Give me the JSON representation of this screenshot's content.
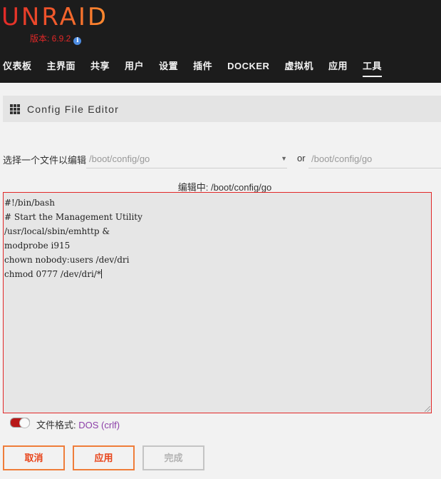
{
  "header": {
    "logo": "UNRAID",
    "version": "版本: 6.9.2",
    "info_icon": "info-icon",
    "nav": [
      {
        "label": "仪表板"
      },
      {
        "label": "主界面"
      },
      {
        "label": "共享"
      },
      {
        "label": "用户"
      },
      {
        "label": "设置"
      },
      {
        "label": "插件"
      },
      {
        "label": "DOCKER"
      },
      {
        "label": "虚拟机"
      },
      {
        "label": "应用"
      },
      {
        "label": "工具",
        "active": true
      }
    ]
  },
  "page": {
    "title": "Config File Editor",
    "title_icon": "grid-icon"
  },
  "file_select": {
    "label": "选择一个文件以编辑",
    "selected": "/boot/config/go",
    "or_label": "or",
    "path_placeholder": "/boot/config/go"
  },
  "editor": {
    "editing_label": "编辑中: /boot/config/go",
    "lines": [
      "#!/bin/bash",
      "# Start the Management Utility",
      "/usr/local/sbin/emhttp &",
      "modprobe i915",
      "chown nobody:users /dev/dri",
      "chmod 0777 /dev/dri/*"
    ]
  },
  "file_format": {
    "label": "文件格式:",
    "value": "DOS (crlf)"
  },
  "buttons": {
    "cancel": "取消",
    "apply": "应用",
    "done": "完成"
  },
  "colors": {
    "accent": "#e8441a",
    "header_bg": "#1c1c1c",
    "editor_border": "#e22828",
    "format_value": "#8c3ea8"
  }
}
